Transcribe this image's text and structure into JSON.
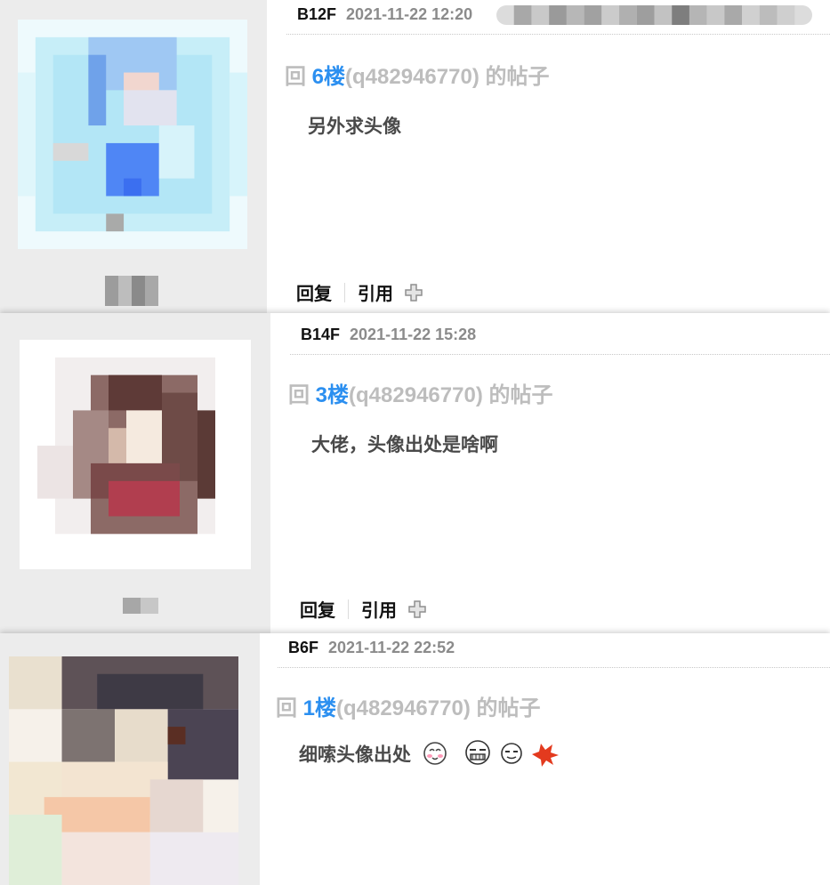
{
  "posts": [
    {
      "floor": "B12F",
      "time": "2021-11-22 12:20",
      "reply_prefix": "回 ",
      "reply_floor": "6楼",
      "reply_user": "(q482946770) 的帖子",
      "content": "另外求头像",
      "actions": {
        "reply": "回复",
        "quote": "引用"
      }
    },
    {
      "floor": "B14F",
      "time": "2021-11-22 15:28",
      "reply_prefix": "回 ",
      "reply_floor": "3楼",
      "reply_user": "(q482946770) 的帖子",
      "content": "大佬，头像出处是啥啊",
      "actions": {
        "reply": "回复",
        "quote": "引用"
      }
    },
    {
      "floor": "B6F",
      "time": "2021-11-22 22:52",
      "reply_prefix": "回 ",
      "reply_floor": "1楼",
      "reply_user": "(q482946770) 的帖子",
      "content": "细嗦头像出处",
      "emoticons": [
        "blush-face-icon",
        "meme-face-icon",
        "meme-face-icon",
        "blood-splat-icon"
      ]
    }
  ],
  "colors": {
    "sidebar": "#ececec",
    "floor_link": "#2b8ff0",
    "muted": "#bdbdbd",
    "time": "#8b8b8b"
  }
}
